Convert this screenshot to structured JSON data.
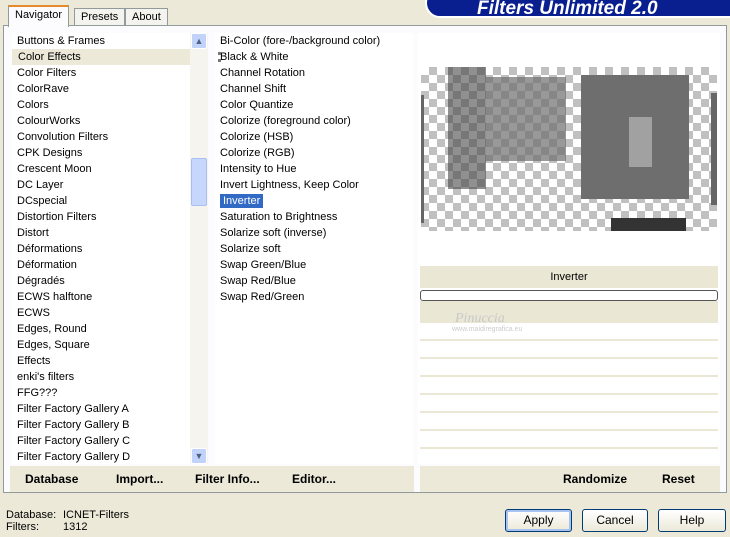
{
  "title": "Filters Unlimited 2.0",
  "tabs": [
    {
      "label": "Navigator"
    },
    {
      "label": "Presets"
    },
    {
      "label": "About"
    }
  ],
  "categories": [
    "Buttons & Frames",
    "Color Effects",
    "Color Filters",
    "ColorRave",
    "Colors",
    "ColourWorks",
    "Convolution Filters",
    "CPK Designs",
    "Crescent Moon",
    "DC Layer",
    "DCspecial",
    "Distortion Filters",
    "Distort",
    "Déformations",
    "Déformation",
    "Dégradés",
    "ECWS halftone",
    "ECWS",
    "Edges, Round",
    "Edges, Square",
    "Effects",
    "enki's filters",
    "FFG???",
    "Filter Factory Gallery A",
    "Filter Factory Gallery B",
    "Filter Factory Gallery C",
    "Filter Factory Gallery D"
  ],
  "selected_category": "Color Effects",
  "filters": [
    "Bi-Color (fore-/background color)",
    "Black & White",
    "Channel Rotation",
    "Channel Shift",
    "Color Quantize",
    "Colorize (foreground color)",
    "Colorize (HSB)",
    "Colorize (RGB)",
    "Intensity to Hue",
    "Invert Lightness, Keep Color",
    "Inverter",
    "Saturation to Brightness",
    "Solarize soft (inverse)",
    "Solarize soft",
    "Swap Green/Blue",
    "Swap Red/Blue",
    "Swap Red/Green"
  ],
  "selected_filter": "Inverter",
  "preview_label": "Inverter",
  "watermark": {
    "name": "Pinuccia",
    "url": "www.maidiregrafica.eu"
  },
  "bottom_buttons": {
    "database": "Database",
    "import": "Import...",
    "filter_info": "Filter Info...",
    "editor": "Editor...",
    "randomize": "Randomize",
    "reset": "Reset"
  },
  "status": {
    "database_label": "Database:",
    "database_value": "ICNET-Filters",
    "filters_label": "Filters:",
    "filters_value": "1312"
  },
  "dialog_buttons": {
    "apply": "Apply",
    "cancel": "Cancel",
    "help": "Help"
  }
}
